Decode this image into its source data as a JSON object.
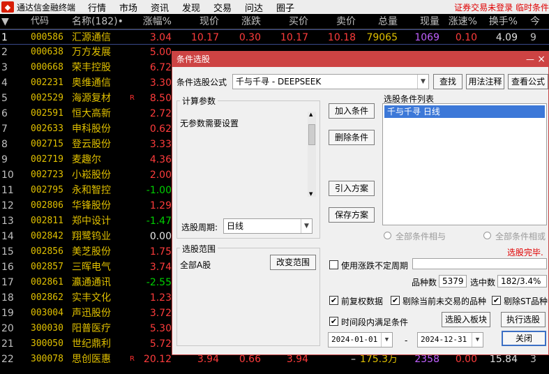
{
  "menubar": {
    "app_title": "通达信金融终端",
    "items": [
      "行情",
      "市场",
      "资讯",
      "发现",
      "交易",
      "问达",
      "圈子"
    ],
    "right_text": "证券交易未登录  临时条件"
  },
  "table": {
    "headers": {
      "idx": "",
      "code": "代码",
      "name": "名称(182)•",
      "chg": "涨幅%",
      "price": "现价",
      "diff": "涨跌",
      "bid": "买价",
      "ask": "卖价",
      "vol": "总量",
      "cur": "现量",
      "spd": "涨速%",
      "turn": "换手%",
      "more": "今"
    },
    "rows": [
      {
        "idx": "1",
        "code": "000586",
        "name": "汇源通信",
        "r": "",
        "chg": "3.04",
        "price": "10.17",
        "diff": "0.30",
        "bid": "10.17",
        "ask": "10.18",
        "vol": "79065",
        "cur": "1069",
        "spd": "0.10",
        "turn": "4.09",
        "more": "9"
      },
      {
        "idx": "2",
        "code": "000638",
        "name": "万方发展",
        "r": "",
        "chg": "5.00",
        "price": "",
        "diff": "",
        "bid": "",
        "ask": "",
        "vol": "",
        "cur": "",
        "spd": "",
        "turn": "",
        "more": ""
      },
      {
        "idx": "3",
        "code": "000668",
        "name": "荣丰控股",
        "r": "",
        "chg": "6.72",
        "price": "",
        "diff": "",
        "bid": "",
        "ask": "",
        "vol": "",
        "cur": "",
        "spd": "",
        "turn": "",
        "more": ""
      },
      {
        "idx": "4",
        "code": "002231",
        "name": "奥维通信",
        "r": "",
        "chg": "3.30",
        "price": "",
        "diff": "",
        "bid": "",
        "ask": "",
        "vol": "",
        "cur": "",
        "spd": "",
        "turn": "",
        "more": ""
      },
      {
        "idx": "5",
        "code": "002529",
        "name": "海源复材",
        "r": "R",
        "chg": "8.50",
        "price": "",
        "diff": "",
        "bid": "",
        "ask": "",
        "vol": "",
        "cur": "",
        "spd": "",
        "turn": "",
        "more": ""
      },
      {
        "idx": "6",
        "code": "002591",
        "name": "恒大高新",
        "r": "",
        "chg": "2.72",
        "price": "",
        "diff": "",
        "bid": "",
        "ask": "",
        "vol": "",
        "cur": "",
        "spd": "",
        "turn": "",
        "more": ""
      },
      {
        "idx": "7",
        "code": "002633",
        "name": "申科股份",
        "r": "",
        "chg": "0.62",
        "price": "",
        "diff": "",
        "bid": "",
        "ask": "",
        "vol": "",
        "cur": "",
        "spd": "",
        "turn": "",
        "more": ""
      },
      {
        "idx": "8",
        "code": "002715",
        "name": "登云股份",
        "r": "",
        "chg": "3.33",
        "price": "",
        "diff": "",
        "bid": "",
        "ask": "",
        "vol": "",
        "cur": "",
        "spd": "",
        "turn": "",
        "more": ""
      },
      {
        "idx": "9",
        "code": "002719",
        "name": "麦趣尔",
        "r": "",
        "chg": "4.36",
        "price": "",
        "diff": "",
        "bid": "",
        "ask": "",
        "vol": "",
        "cur": "",
        "spd": "",
        "turn": "",
        "more": ""
      },
      {
        "idx": "10",
        "code": "002723",
        "name": "小崧股份",
        "r": "",
        "chg": "2.00",
        "price": "",
        "diff": "",
        "bid": "",
        "ask": "",
        "vol": "",
        "cur": "",
        "spd": "",
        "turn": "",
        "more": ""
      },
      {
        "idx": "11",
        "code": "002795",
        "name": "永和智控",
        "r": "",
        "chg": "-1.00",
        "price": "",
        "diff": "",
        "bid": "",
        "ask": "",
        "vol": "",
        "cur": "",
        "spd": "",
        "turn": "",
        "more": ""
      },
      {
        "idx": "12",
        "code": "002806",
        "name": "华锋股份",
        "r": "",
        "chg": "1.29",
        "price": "",
        "diff": "",
        "bid": "",
        "ask": "",
        "vol": "",
        "cur": "",
        "spd": "",
        "turn": "",
        "more": ""
      },
      {
        "idx": "13",
        "code": "002811",
        "name": "郑中设计",
        "r": "",
        "chg": "-1.47",
        "price": "",
        "diff": "",
        "bid": "",
        "ask": "",
        "vol": "",
        "cur": "",
        "spd": "",
        "turn": "",
        "more": ""
      },
      {
        "idx": "14",
        "code": "002842",
        "name": "翔鹭钨业",
        "r": "",
        "chg": "0.00",
        "price": "",
        "diff": "",
        "bid": "",
        "ask": "",
        "vol": "",
        "cur": "",
        "spd": "",
        "turn": "",
        "more": ""
      },
      {
        "idx": "15",
        "code": "002856",
        "name": "美芝股份",
        "r": "",
        "chg": "1.75",
        "price": "",
        "diff": "",
        "bid": "",
        "ask": "",
        "vol": "",
        "cur": "",
        "spd": "",
        "turn": "",
        "more": ""
      },
      {
        "idx": "16",
        "code": "002857",
        "name": "三晖电气",
        "r": "",
        "chg": "3.74",
        "price": "",
        "diff": "",
        "bid": "",
        "ask": "",
        "vol": "",
        "cur": "",
        "spd": "",
        "turn": "",
        "more": ""
      },
      {
        "idx": "17",
        "code": "002861",
        "name": "瀛通通讯",
        "r": "",
        "chg": "-2.55",
        "price": "",
        "diff": "",
        "bid": "",
        "ask": "",
        "vol": "",
        "cur": "",
        "spd": "",
        "turn": "",
        "more": ""
      },
      {
        "idx": "18",
        "code": "002862",
        "name": "实丰文化",
        "r": "",
        "chg": "1.23",
        "price": "",
        "diff": "",
        "bid": "",
        "ask": "",
        "vol": "",
        "cur": "",
        "spd": "",
        "turn": "",
        "more": ""
      },
      {
        "idx": "19",
        "code": "003004",
        "name": "声迅股份",
        "r": "",
        "chg": "3.72",
        "price": "",
        "diff": "",
        "bid": "",
        "ask": "",
        "vol": "",
        "cur": "",
        "spd": "",
        "turn": "",
        "more": ""
      },
      {
        "idx": "20",
        "code": "300030",
        "name": "阳普医疗",
        "r": "",
        "chg": "5.30",
        "price": "",
        "diff": "",
        "bid": "",
        "ask": "",
        "vol": "",
        "cur": "",
        "spd": "",
        "turn": "",
        "more": ""
      },
      {
        "idx": "21",
        "code": "300050",
        "name": "世纪鼎利",
        "r": "",
        "chg": "5.72",
        "price": "",
        "diff": "",
        "bid": "",
        "ask": "",
        "vol": "",
        "cur": "",
        "spd": "",
        "turn": "",
        "more": ""
      },
      {
        "idx": "22",
        "code": "300078",
        "name": "思创医惠",
        "r": "R",
        "chg": "20.12",
        "price": "3.94",
        "diff": "0.66",
        "bid": "3.94",
        "ask": "–",
        "vol": "175.3万",
        "cur": "2358",
        "spd": "0.00",
        "turn": "15.84",
        "more": "3"
      }
    ]
  },
  "dialog": {
    "title": "条件选股",
    "formula_label": "条件选股公式",
    "formula_value": "千与千寻      - DEEPSEEK",
    "btn_find": "查找",
    "btn_usage": "用法注释",
    "btn_view": "查看公式",
    "calc_group": "计算参数",
    "calc_text": "无参数需要设置",
    "period_label": "选股周期:",
    "period_value": "日线",
    "btn_add": "加入条件",
    "btn_delete": "删除条件",
    "btn_import": "引入方案",
    "btn_save": "保存方案",
    "list_label": "选股条件列表",
    "list_items": [
      "千与千寻  日线"
    ],
    "radio_and": "全部条件相与",
    "radio_or": "全部条件相或",
    "status": "选股完毕.",
    "range_group": "选股范围",
    "range_value": "全部A股",
    "btn_range": "改变范围",
    "indef_label": "使用涨跌不定周期",
    "count_label": "品种数",
    "count_value": "5379",
    "selected_label": "选中数",
    "selected_value": "182/3.4%",
    "opt_fq": "前复权数据",
    "opt_exclude_notrade": "剔除当前未交易的品种",
    "opt_exclude_st": "剔除ST品种",
    "opt_time": "时间段内满足条件",
    "btn_to_block": "选股入板块",
    "btn_execute": "执行选股",
    "date_from": "2024-01-01",
    "date_sep": "-",
    "date_to": "2024-12-31",
    "btn_close": "关闭"
  }
}
